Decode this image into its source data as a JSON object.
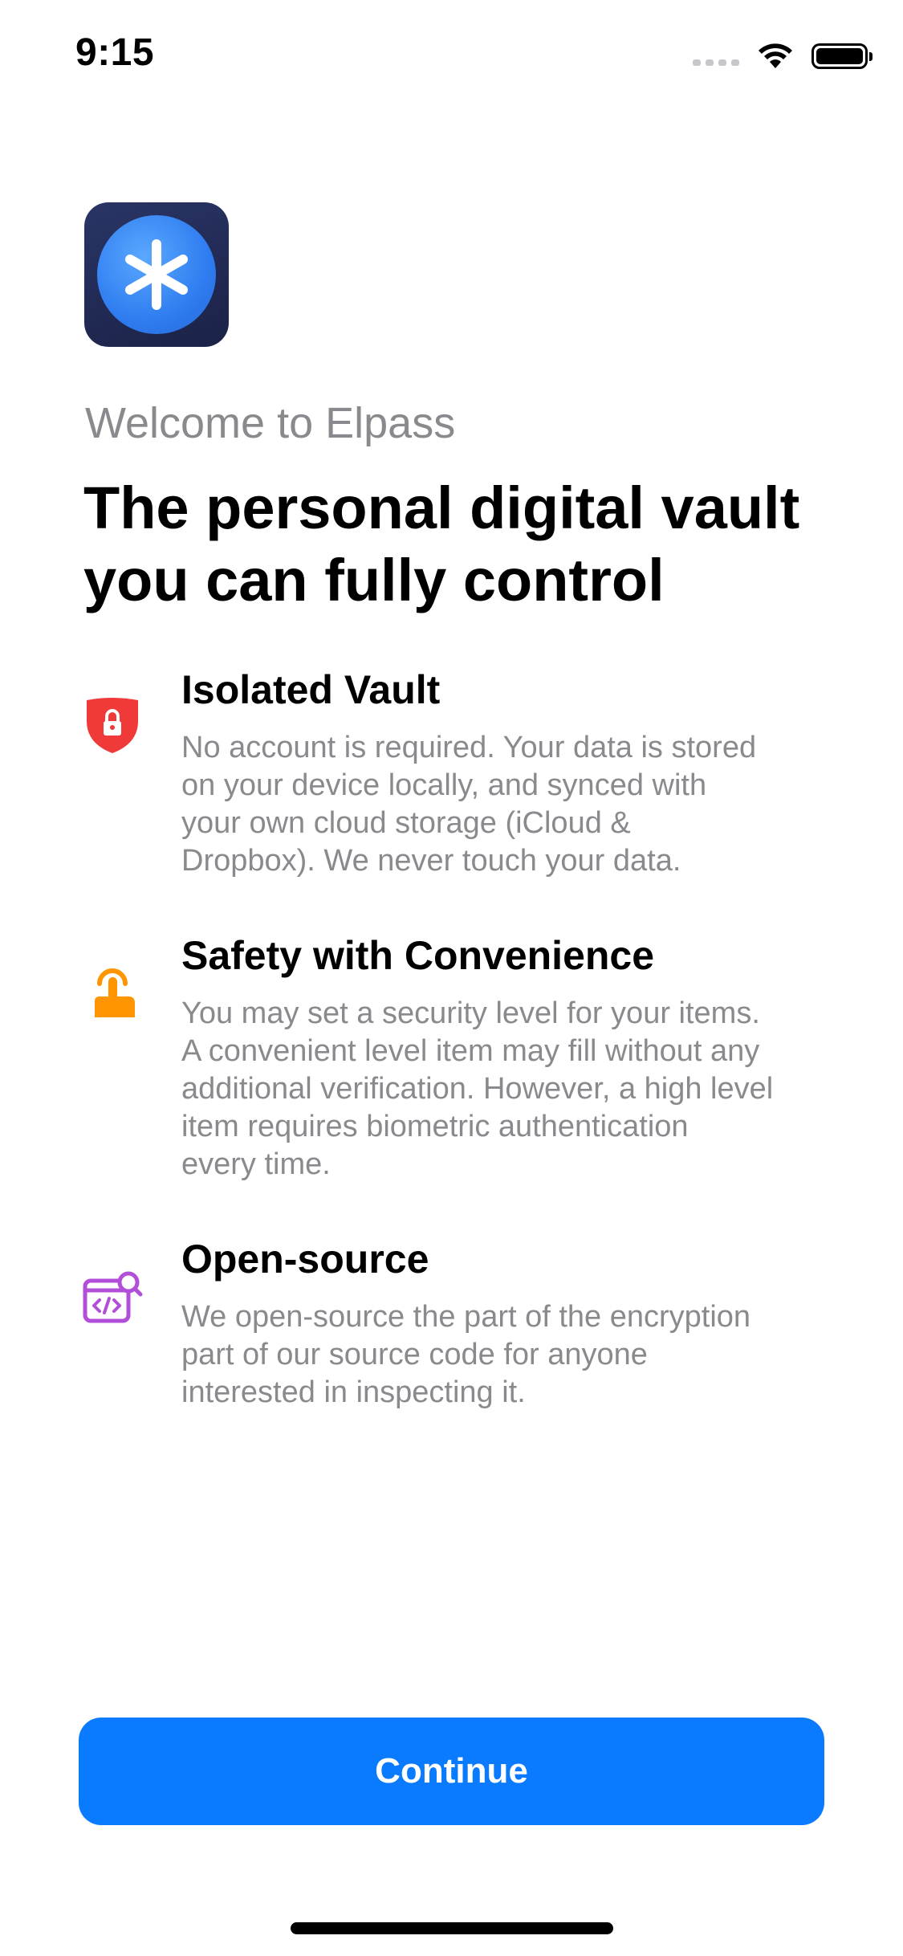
{
  "status_bar": {
    "time": "9:15",
    "icons": [
      "cellular-signal-icon",
      "wifi-icon",
      "battery-icon"
    ]
  },
  "app": {
    "icon": "asterisk-icon",
    "colors": {
      "icon_background": "#1f2752",
      "icon_circle": "#3b8cf5"
    }
  },
  "welcome_text": "Welcome to Elpass",
  "headline": {
    "line1": "The personal digital vault",
    "line2": "you can fully control"
  },
  "features": [
    {
      "icon": "shield-lock-icon",
      "icon_color": "#f03a3a",
      "title": "Isolated Vault",
      "lines": [
        "No account is required. Your data is stored",
        "on your device locally, and synced with",
        "your own cloud storage (iCloud &",
        "Dropbox).  We never touch your data."
      ]
    },
    {
      "icon": "touch-hand-icon",
      "icon_color": "#ff9500",
      "title": "Safety with Convenience",
      "lines": [
        "You may set a security level for your items.",
        "A convenient level item may fill without any",
        "additional verification. However, a high level",
        "item requires biometric authentication",
        "every time."
      ]
    },
    {
      "icon": "code-inspect-icon",
      "icon_color": "#b24fd8",
      "title": "Open-source",
      "lines": [
        "We open-source the part of the encryption",
        "part of our source code for anyone",
        "interested in inspecting it."
      ]
    }
  ],
  "continue_button": {
    "label": "Continue",
    "color": "#0a7aff"
  }
}
